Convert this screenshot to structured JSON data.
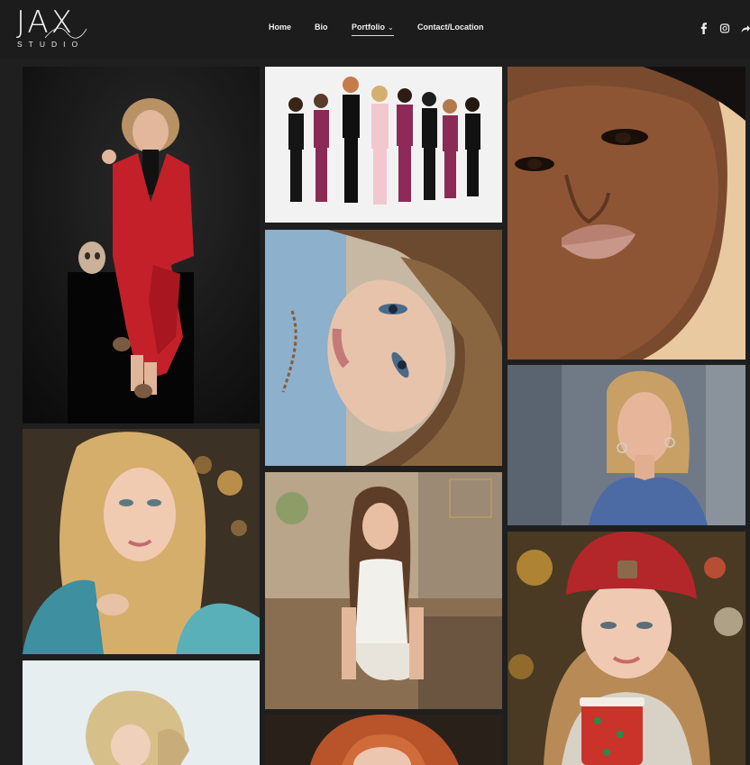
{
  "header": {
    "logo": {
      "main": "JAX",
      "sub": "STUDIO"
    },
    "nav": [
      {
        "label": "Home"
      },
      {
        "label": "Bio"
      },
      {
        "label": "Portfolio",
        "active": true,
        "has_dropdown": true
      },
      {
        "label": "Contact/Location"
      }
    ],
    "social_icons": [
      "facebook-icon",
      "instagram-icon",
      "share-icon"
    ]
  },
  "gallery": {
    "items": [
      {
        "subject": "woman in red suit with skull",
        "icon": "portrait-photo"
      },
      {
        "subject": "medical team group photo",
        "icon": "group-photo"
      },
      {
        "subject": "close-up beauty portrait",
        "icon": "portrait-photo"
      },
      {
        "subject": "woman lying down portrait",
        "icon": "portrait-photo"
      },
      {
        "subject": "woman in blue shirt",
        "icon": "portrait-photo"
      },
      {
        "subject": "blonde woman portrait",
        "icon": "portrait-photo"
      },
      {
        "subject": "senior portrait outdoors",
        "icon": "portrait-photo"
      },
      {
        "subject": "girl with red beanie and cup",
        "icon": "portrait-photo"
      },
      {
        "subject": "blonde woman white background",
        "icon": "portrait-photo"
      },
      {
        "subject": "redhead portrait",
        "icon": "portrait-photo"
      }
    ]
  },
  "colors": {
    "background": "#1f1f1f",
    "header": "#1c1c1c",
    "text": "#f0f0f0"
  }
}
